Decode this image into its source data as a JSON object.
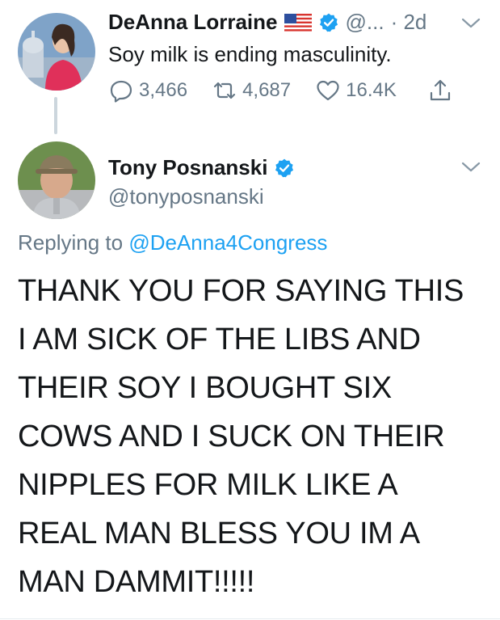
{
  "tweet1": {
    "author_name": "DeAnna Lorraine",
    "handle": "@...",
    "time": "· 2d",
    "text": "Soy milk is ending masculinity.",
    "replies": "3,466",
    "retweets": "4,687",
    "likes": "16.4K"
  },
  "tweet2": {
    "author_name": "Tony Posnanski",
    "handle": "@tonyposnanski",
    "replying_prefix": "Replying to",
    "replying_to": "@DeAnna4Congress",
    "lines": [
      "THANK YOU FOR SAYING THIS",
      "I AM SICK OF THE LIBS AND",
      "THEIR SOY I BOUGHT SIX",
      "COWS AND I SUCK ON THEIR",
      "NIPPLES FOR MILK LIKE A",
      "REAL MAN BLESS YOU IM A",
      "MAN DAMMIT!!!!!"
    ]
  },
  "colors": {
    "accent": "#1da1f2",
    "secondary_text": "#657786",
    "primary_text": "#14171a"
  },
  "icons": [
    "us-flag-icon",
    "verified-badge-icon",
    "chevron-down-icon",
    "reply-icon",
    "retweet-icon",
    "like-icon",
    "share-icon"
  ]
}
